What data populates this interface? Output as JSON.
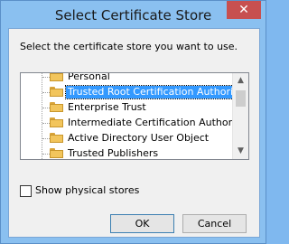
{
  "window": {
    "title": "Select Certificate Store",
    "close_glyph": "✕"
  },
  "instruction": "Select the certificate store you want to use.",
  "stores": [
    {
      "label": "Personal",
      "selected": false
    },
    {
      "label": "Trusted Root Certification Authorities",
      "selected": true
    },
    {
      "label": "Enterprise Trust",
      "selected": false
    },
    {
      "label": "Intermediate Certification Authorities",
      "selected": false
    },
    {
      "label": "Active Directory User Object",
      "selected": false
    },
    {
      "label": "Trusted Publishers",
      "selected": false
    }
  ],
  "scroll": {
    "up_glyph": "▲",
    "down_glyph": "▼"
  },
  "options": {
    "show_physical_label": "Show physical stores",
    "show_physical_checked": false
  },
  "buttons": {
    "ok": "OK",
    "cancel": "Cancel"
  },
  "colors": {
    "titlebar": "#8ac0f0",
    "selection": "#3399ff",
    "close": "#c75050"
  }
}
